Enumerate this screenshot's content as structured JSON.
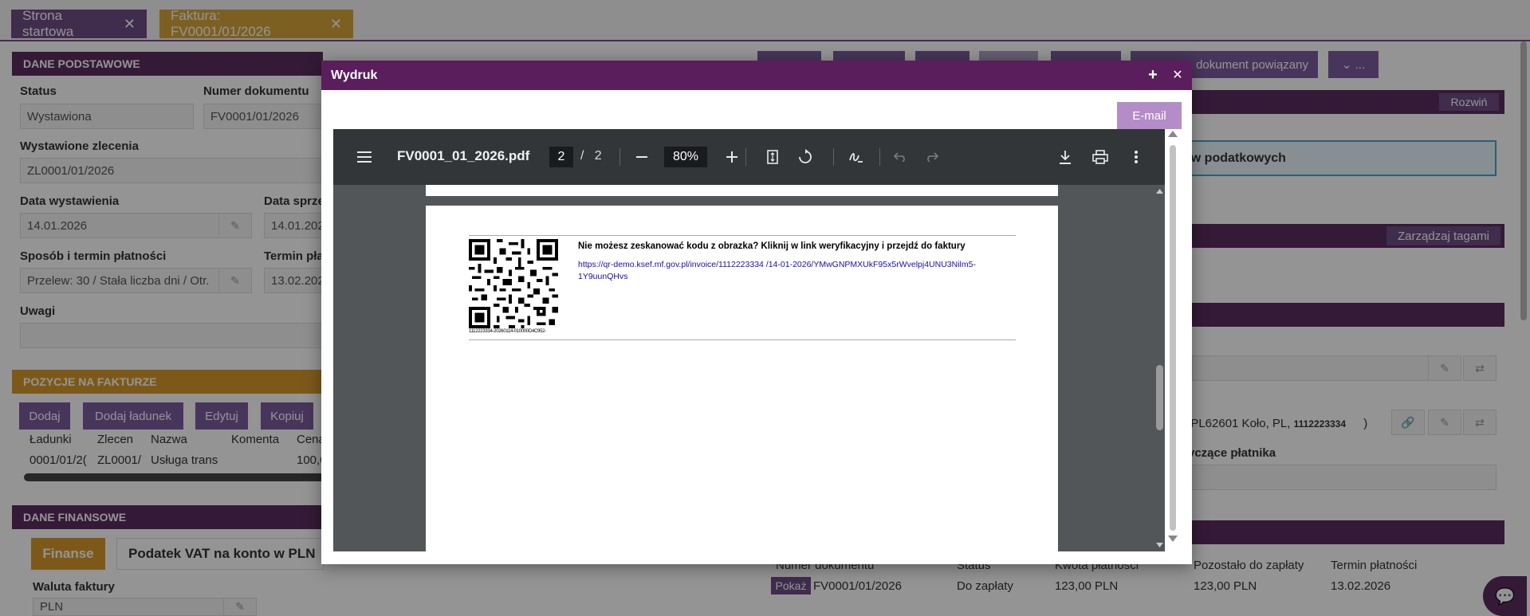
{
  "tabs": [
    {
      "label": "Strona startowa",
      "close": "✕"
    },
    {
      "label": "Faktura: FV0001/01/2026",
      "close": "✕"
    }
  ],
  "basic": {
    "header": "DANE PODSTAWOWE",
    "status_label": "Status",
    "status_value": "Wystawiona",
    "docnum_label": "Numer dokumentu",
    "docnum_value": "FV0001/01/2026",
    "orders_label": "Wystawione zlecenia",
    "orders_value": "ZL0001/01/2026",
    "issue_date_label": "Data wystawienia",
    "issue_date_value": "14.01.2026",
    "sale_date_label": "Data sprze",
    "sale_date_value": "14.01.202",
    "payment_label": "Sposób i termin płatności",
    "payment_value": "Przelew: 30 / Stała liczba dni / Otr.",
    "due_label": "Termin pła",
    "due_value": "13.02.202",
    "notes_label": "Uwagi"
  },
  "positions": {
    "header": "POZYCJE NA FAKTURZE",
    "buttons": [
      "Dodaj",
      "Dodaj ładunek",
      "Edytuj",
      "Kopiuj"
    ],
    "columns": [
      "Ładunki",
      "Zlecen",
      "Nazwa",
      "Komenta",
      "Cena"
    ],
    "row": [
      "0001/01/2(",
      "ZL0001/",
      "Usługa trans",
      "",
      "100,0"
    ]
  },
  "finance": {
    "header": "DANE FINANSOWE",
    "tab_active": "Finanse",
    "tab_other": "Podatek VAT na konto w PLN",
    "currency_label": "Waluta faktury",
    "currency_value": "PLN"
  },
  "right": {
    "related_btn": "z dokument powiązany",
    "more_btn": "⌄ ...",
    "expand": "Rozwiń",
    "tax_btn": "ów podatkowych",
    "tags": "Zarządzaj tagami",
    "address_frag": ", PL62601 Koło, PL,",
    "nip_frag": "1112223334",
    "paren": ")",
    "payer_label": "tyczące płatnika",
    "table_headers": [
      "Numer dokumentu",
      "Status",
      "Kwota płatności",
      "Pozostało do zapłaty",
      "Termin płatności"
    ],
    "table_row": {
      "show": "Pokaż",
      "doc": "FV0001/01/2026",
      "status": "Do zapłaty",
      "amount": "123,00 PLN",
      "left": "123,00 PLN",
      "due": "13.02.2026"
    }
  },
  "modal": {
    "title": "Wydruk",
    "plus": "+",
    "close": "✕",
    "email": "E-mail"
  },
  "pdf": {
    "filename": "FV0001_01_2026.pdf",
    "page_current": "2",
    "page_sep": "/",
    "page_total": "2",
    "zoom": "80%",
    "heading": "Nie możesz zeskanować kodu z obrazka? Kliknij w link weryfikacyjny i przejdź do faktury",
    "link": "https://qr-demo.ksef.mf.gov.pl/invoice/1112223334 /14-01-2026/YMwGNPMXUkF95x5rWvelpj4UNU3Nilm5-1Y9uunQHvs",
    "qr_caption": "1112223334-20260114-010000D4C952-"
  },
  "icons": {
    "menu": "menu-icon",
    "zoom_out": "minus-icon",
    "zoom_in": "plus-icon",
    "fit": "fit-page-icon",
    "rotate": "rotate-icon",
    "draw": "draw-icon",
    "undo": "undo-icon",
    "redo": "redo-icon",
    "download": "download-icon",
    "print": "print-icon",
    "more": "more-vert-icon",
    "chat": "chat-icon"
  }
}
